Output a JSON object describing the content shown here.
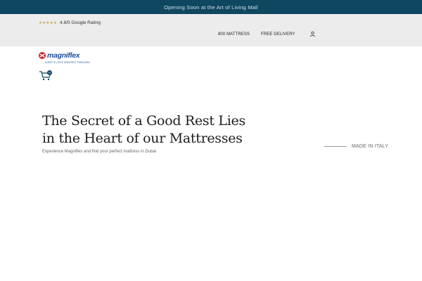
{
  "announcement": {
    "text": "Opening Soon at the Art of Living Mall"
  },
  "rating": {
    "stars": "★★★★★",
    "text": "4.8/5 Google Rating"
  },
  "nav": {
    "items": [
      {
        "label": "800 MATTRESS"
      },
      {
        "label": "FREE DELIVERY"
      }
    ],
    "account_icon": "user-icon"
  },
  "logo": {
    "brand": "magniflex",
    "tagline": "SLEEP IS LIFE'S GREATEST TREASURE"
  },
  "cart": {
    "icon": "cart-icon",
    "count": "0"
  },
  "hero": {
    "title_line1": "The Secret of a Good Rest Lies",
    "title_line2": "in the Heart of our Mattresses",
    "subtitle": "Experience Magniflex and find your perfect mattress in Dubai"
  },
  "made_in": {
    "text": "MADE IN ITALY"
  },
  "colors": {
    "announce_bg": "#0f4660",
    "topbar_bg": "#ececec",
    "brand_blue": "#1c4f9a",
    "star_gold": "#c9a54b"
  }
}
